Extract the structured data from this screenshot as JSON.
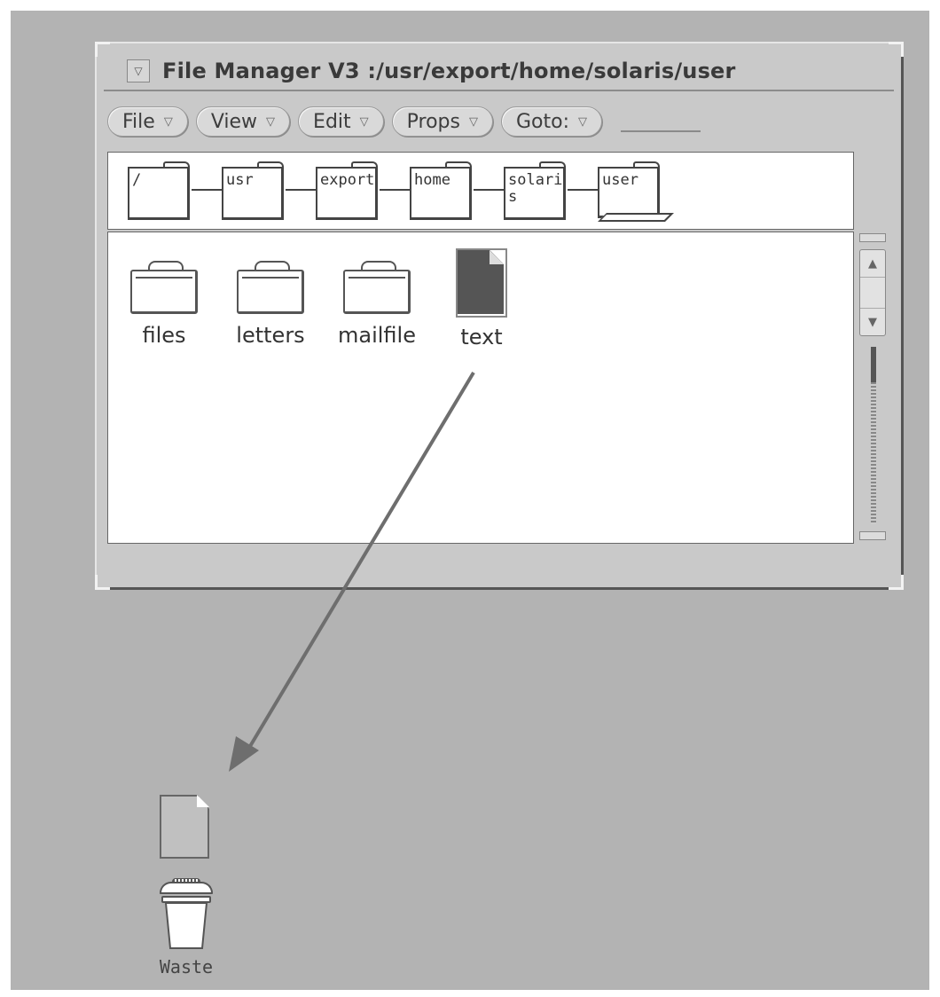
{
  "window": {
    "title": "File Manager V3  :/usr/export/home/solaris/user",
    "menu_glyph": "▽"
  },
  "menubar": {
    "items": [
      {
        "label": "File",
        "arrow": "▽"
      },
      {
        "label": "View",
        "arrow": "▽"
      },
      {
        "label": "Edit",
        "arrow": "▽"
      },
      {
        "label": "Props",
        "arrow": "▽"
      },
      {
        "label": "Goto:",
        "arrow": "▽"
      }
    ]
  },
  "path": {
    "folders": [
      "/",
      "usr",
      "export",
      "home",
      "solaris",
      "user"
    ],
    "current": "user"
  },
  "files": [
    {
      "name": "files",
      "kind": "folder"
    },
    {
      "name": "letters",
      "kind": "folder"
    },
    {
      "name": "mailfile",
      "kind": "folder"
    },
    {
      "name": "text",
      "kind": "document",
      "selected": true
    }
  ],
  "scrollbar": {
    "up_glyph": "▲",
    "down_glyph": "▼"
  },
  "desktop": {
    "waste_label": "Waste",
    "drag_action": "drag text file to Waste"
  },
  "colors": {
    "desktop": "#b3b3b3",
    "window": "#c9c9c9",
    "pane": "#ffffff",
    "arrow": "#6e6e6e",
    "selected_doc": "#555555"
  }
}
